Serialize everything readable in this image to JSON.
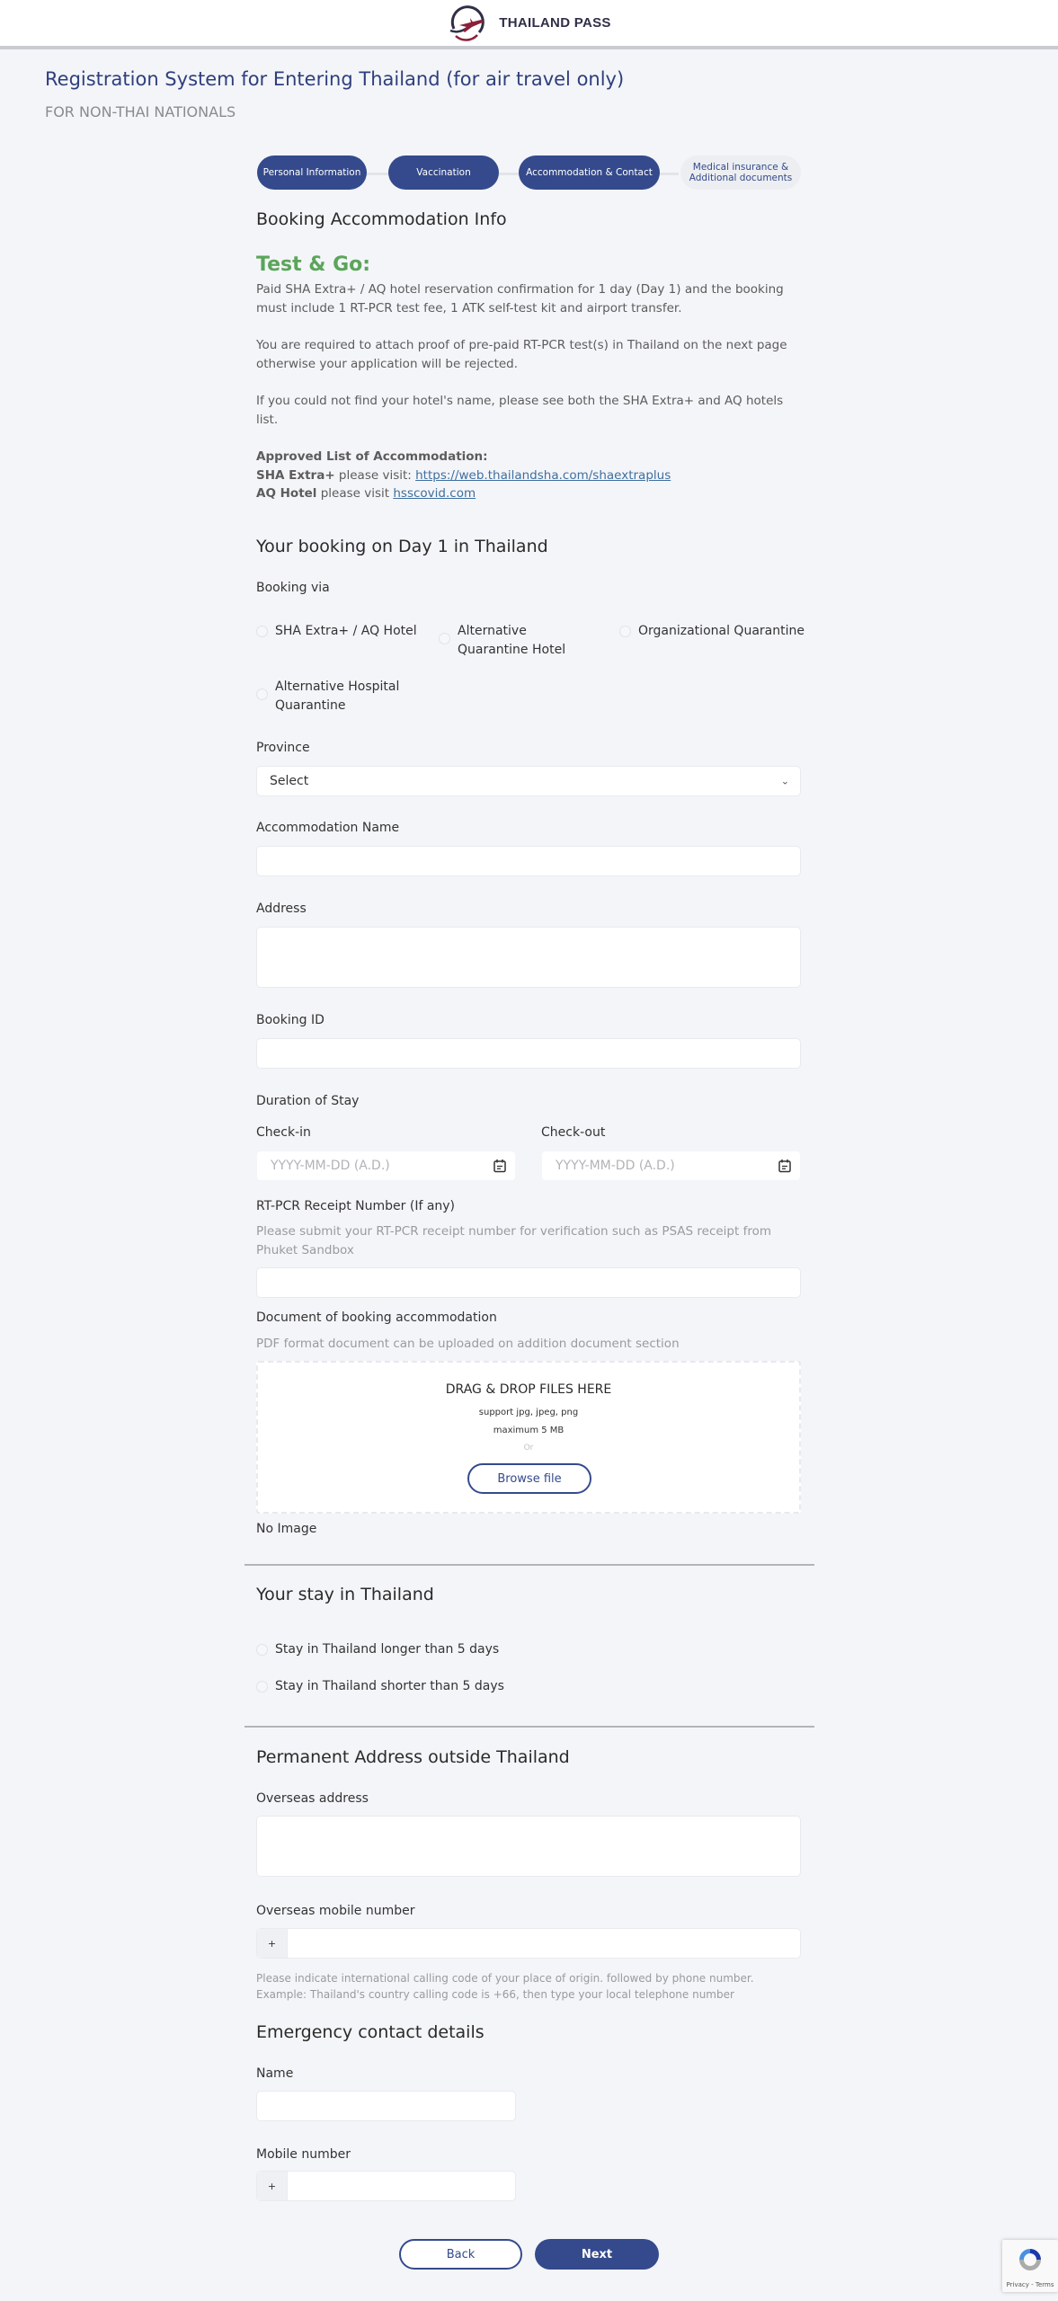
{
  "header": {
    "brand_name": "THAILAND PASS",
    "logo_icon": "plane-globe-logo"
  },
  "page": {
    "title": "Registration System for Entering Thailand (for air travel only)",
    "subtitle": "FOR NON-THAI NATIONALS"
  },
  "stepper": {
    "steps": [
      {
        "label": "Personal Information",
        "state": "complete"
      },
      {
        "label": "Vaccination",
        "state": "complete"
      },
      {
        "label": "Accommodation & Contact",
        "state": "current"
      },
      {
        "label": "Medical insurance & Additional documents",
        "label_line1": "Medical insurance &",
        "label_line2": "Additional documents",
        "state": "upcoming"
      }
    ]
  },
  "booking_info": {
    "heading": "Booking Accommodation Info",
    "test_go_title": "Test & Go:",
    "test_go_text": "Paid SHA Extra+ / AQ hotel reservation confirmation for 1 day (Day 1) and the booking must include 1 RT-PCR test fee, 1 ATK self-test kit and airport transfer.",
    "proof_text": "You are required to attach proof of pre-paid RT-PCR test(s) in Thailand on the next page otherwise your application will be rejected.",
    "hotel_text": "If you could not find your hotel's name, please see both the SHA Extra+ and AQ hotels list.",
    "approved_title": "Approved List of Accommodation:",
    "sha_label": "SHA Extra+",
    "sha_text": " please visit: ",
    "sha_link": "https://web.thailandsha.com/shaextraplus",
    "aq_label": "AQ Hotel",
    "aq_text": " please visit ",
    "aq_link": "hsscovid.com"
  },
  "booking_day1": {
    "heading": "Your booking on Day 1 in Thailand",
    "booking_via_label": "Booking via",
    "options": [
      "SHA Extra+ / AQ Hotel",
      "Alternative Quarantine Hotel",
      "Organizational Quarantine",
      "Alternative Hospital Quarantine"
    ],
    "province_label": "Province",
    "province_value": "Select",
    "accommodation_name_label": "Accommodation Name",
    "accommodation_name_value": "",
    "address_label": "Address",
    "address_value": "",
    "booking_id_label": "Booking ID",
    "booking_id_value": "",
    "duration_label": "Duration of Stay",
    "checkin_label": "Check-in",
    "checkin_placeholder": "YYYY-MM-DD (A.D.)",
    "checkout_label": "Check-out",
    "checkout_placeholder": "YYYY-MM-DD (A.D.)",
    "rtpcr_label": "RT-PCR Receipt Number (If any)",
    "rtpcr_hint": "Please submit your RT-PCR receipt number for verification such as PSAS receipt from Phuket Sandbox",
    "rtpcr_value": "",
    "document_label": "Document of booking accommodation",
    "document_hint": "PDF format document can be uploaded on addition document section",
    "dropzone": {
      "title": "DRAG & DROP FILES HERE",
      "support": "support jpg, jpeg, png",
      "max": "maximum 5 MB",
      "or": "Or",
      "browse": "Browse file"
    },
    "no_image": "No Image"
  },
  "stay": {
    "heading": "Your stay in Thailand",
    "options": [
      "Stay in Thailand longer than 5 days",
      "Stay in Thailand shorter than 5 days"
    ]
  },
  "permanent_address": {
    "heading": "Permanent Address outside Thailand",
    "overseas_address_label": "Overseas address",
    "overseas_address_value": "",
    "overseas_mobile_label": "Overseas mobile number",
    "mobile_prefix": "+",
    "overseas_mobile_value": "",
    "mobile_hint": "Please indicate international calling code of your place of origin. followed by phone number. Example: Thailand's country calling code is +66, then type your local telephone number"
  },
  "emergency": {
    "heading": "Emergency contact details",
    "name_label": "Name",
    "name_value": "",
    "mobile_label": "Mobile number",
    "mobile_prefix": "+",
    "mobile_value": ""
  },
  "actions": {
    "back": "Back",
    "next": "Next"
  },
  "recaptcha": {
    "text": "Privacy - Terms"
  },
  "colors": {
    "primary": "#344a8c",
    "green_heading": "#5ba55a",
    "link": "#3f6f9e",
    "background": "#f4f5f9"
  }
}
